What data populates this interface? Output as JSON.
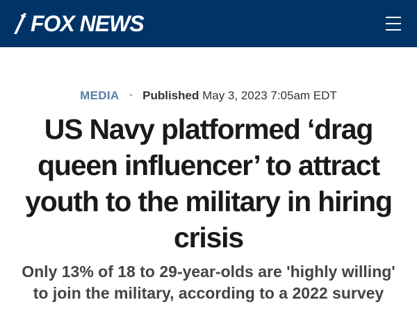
{
  "header": {
    "logo_text": "FOX NEWS",
    "logo_icon": "fox-slash-mark",
    "menu_icon": "hamburger-menu-icon",
    "background_color": "#003366"
  },
  "article": {
    "category": "MEDIA",
    "separator": "•",
    "published_label": "Published",
    "published_date": "May 3, 2023 7:05am EDT",
    "headline": "US Navy platformed ‘drag queen influencer’ to attract youth to the military in hiring crisis",
    "subheadline": "Only 13% of 18 to 29-year-olds are 'highly willing' to join the military, according to a 2022 survey"
  },
  "colors": {
    "category": "#5a7ea6",
    "headline": "#1a1a1a",
    "subheadline": "#444444"
  }
}
